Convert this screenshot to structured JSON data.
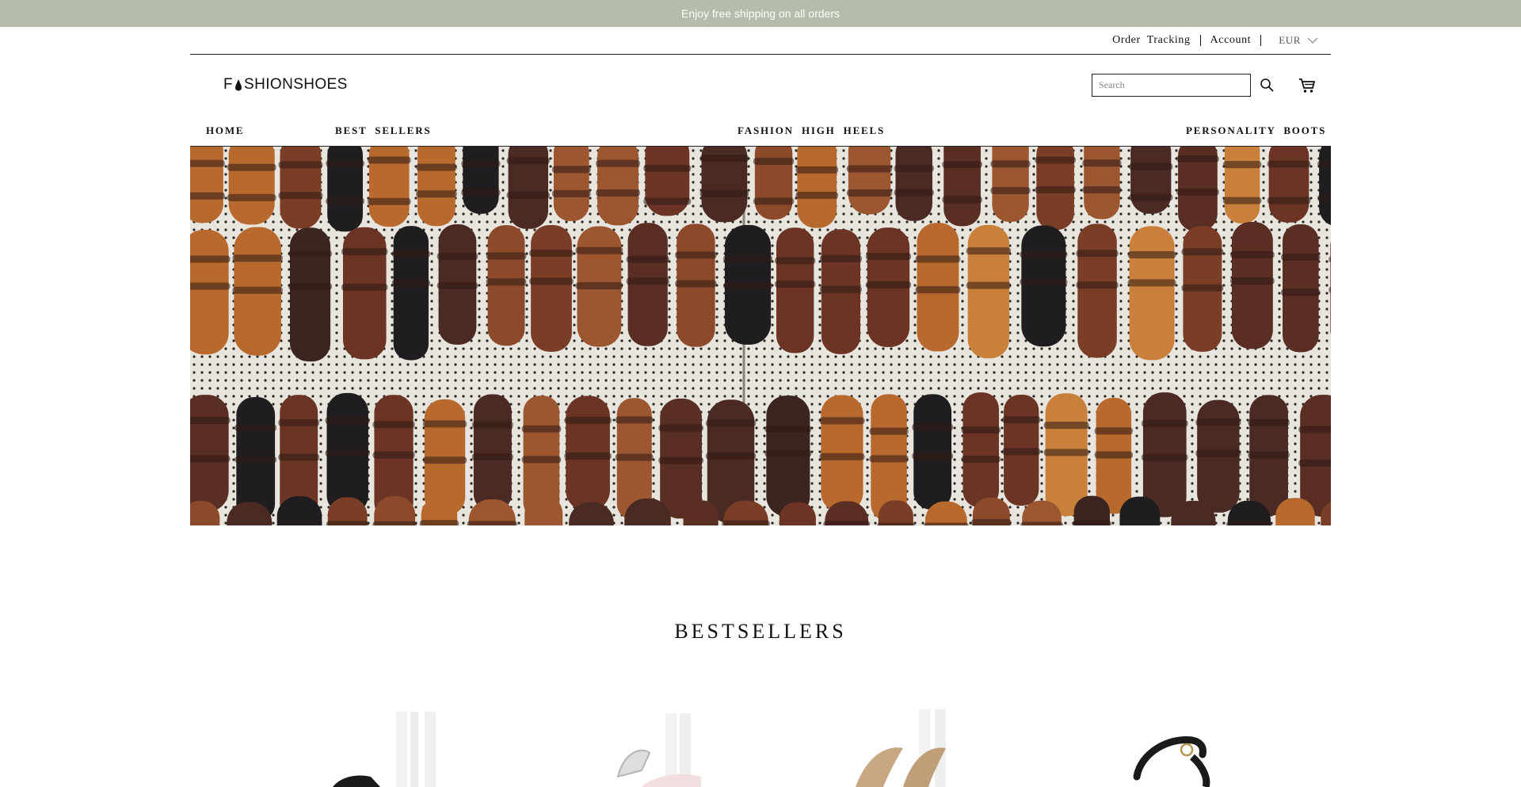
{
  "announcement": "Enjoy free shipping on all orders",
  "utility": {
    "order_tracking": "Order  Tracking",
    "account": "Account",
    "currency": "EUR"
  },
  "brand": {
    "logo_prefix": "F",
    "logo_suffix": "SHIONSHOES"
  },
  "search": {
    "placeholder": "Search"
  },
  "nav": {
    "home": "HOME",
    "best_sellers": "BEST  SELLERS",
    "fashion_high_heels": "FASHION  HIGH  HEELS",
    "personality_boots": "PERSONALITY  BOOTS"
  },
  "bestsellers": {
    "title": "BESTSELLERS"
  },
  "icons": {
    "search": "magnifier-icon",
    "cart": "shopping-cart-icon",
    "currency": "chevron-down-icon"
  },
  "colors": {
    "announcement_bg": "#b4bcaa",
    "text": "#111111"
  }
}
